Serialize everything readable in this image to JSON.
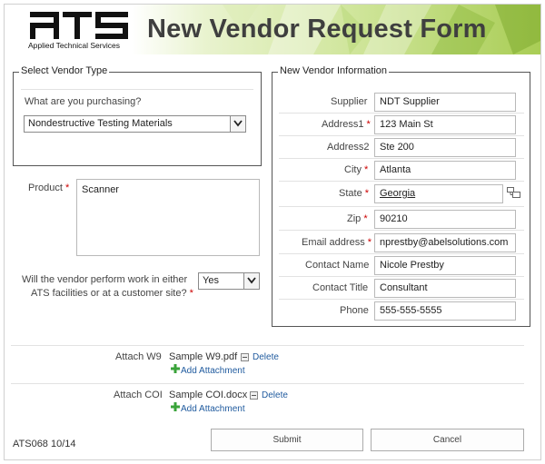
{
  "header": {
    "logo_text": "Applied Technical Services",
    "title": "New Vendor Request Form"
  },
  "vendor_type": {
    "legend": "Select Vendor Type",
    "question": "What are you purchasing?",
    "selected": "Nondestructive Testing Materials"
  },
  "product": {
    "label": "Product",
    "value": "Scanner"
  },
  "work_site": {
    "question_line1": "Will the vendor perform work in either",
    "question_line2": "ATS facilities or at a customer site?",
    "selected": "Yes"
  },
  "vendor_info": {
    "legend": "New Vendor Information",
    "fields": [
      {
        "label": "Supplier",
        "required": false,
        "value": "NDT Supplier"
      },
      {
        "label": "Address1",
        "required": true,
        "value": "123 Main St"
      },
      {
        "label": "Address2",
        "required": false,
        "value": "Ste 200"
      },
      {
        "label": "City",
        "required": true,
        "value": "Atlanta"
      },
      {
        "label": "State",
        "required": true,
        "value": "Georgia"
      },
      {
        "label": "Zip",
        "required": true,
        "value": "90210"
      },
      {
        "label": "Email address",
        "required": true,
        "value": "nprestby@abelsolutions.com"
      },
      {
        "label": "Contact Name",
        "required": false,
        "value": "Nicole Prestby"
      },
      {
        "label": "Contact Title",
        "required": false,
        "value": "Consultant"
      },
      {
        "label": "Phone",
        "required": false,
        "value": "555-555-5555"
      }
    ]
  },
  "attachments": {
    "w9_label": "Attach W9",
    "w9_file": "Sample W9.pdf",
    "coi_label": "Attach COI",
    "coi_file": "Sample COI.docx",
    "delete_label": "Delete",
    "add_label": "Add Attachment"
  },
  "footer": {
    "form_code": "ATS068 10/14",
    "submit_label": "Submit",
    "cancel_label": "Cancel"
  },
  "colors": {
    "title": "#3f3f3f",
    "required": "#cc0000",
    "link": "#1f5a9e",
    "header_green": "#9bc33c"
  }
}
